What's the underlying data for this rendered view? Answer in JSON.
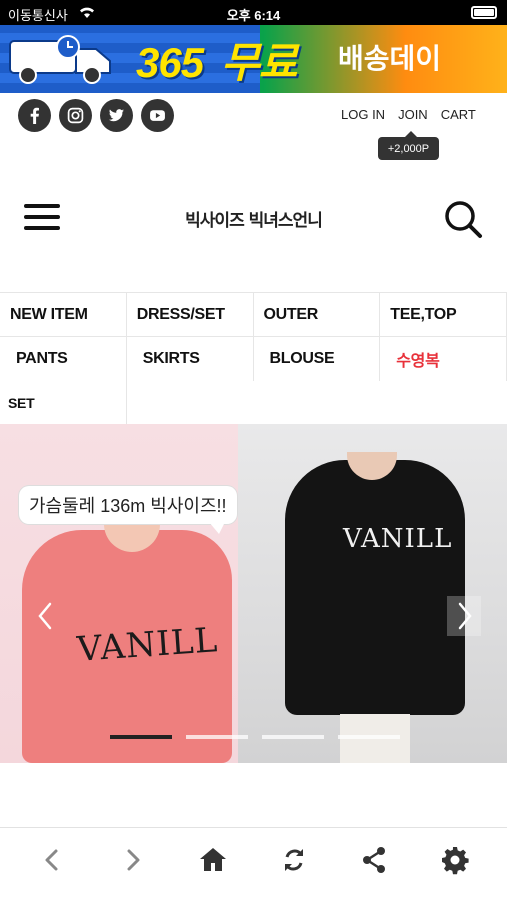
{
  "status_bar": {
    "carrier": "이동통신사",
    "time": "오후 6:14"
  },
  "promo": {
    "number": "365",
    "free": "무료",
    "tagline": "배송데이"
  },
  "social": [
    "facebook-icon",
    "instagram-icon",
    "twitter-icon",
    "youtube-icon"
  ],
  "account_links": {
    "login": "LOG IN",
    "join": "JOIN",
    "cart": "CART",
    "points_badge": "+2,000P"
  },
  "header": {
    "logo": "빅사이즈 빅녀스언니"
  },
  "categories": {
    "row1": [
      "NEW ITEM",
      "DRESS/SET",
      "OUTER",
      "TEE,TOP"
    ],
    "row2": [
      "PANTS",
      "SKIRTS",
      "BLOUSE",
      "수영복"
    ],
    "row3": [
      "SET"
    ]
  },
  "slider": {
    "caption": "가슴둘레 136m 빅사이즈!!",
    "print_left": "VANILL",
    "print_right": "VANILL",
    "active_slide": 1,
    "total_slides": 4
  },
  "colors": {
    "accent_red": "#e8313a",
    "dark": "#333333"
  }
}
